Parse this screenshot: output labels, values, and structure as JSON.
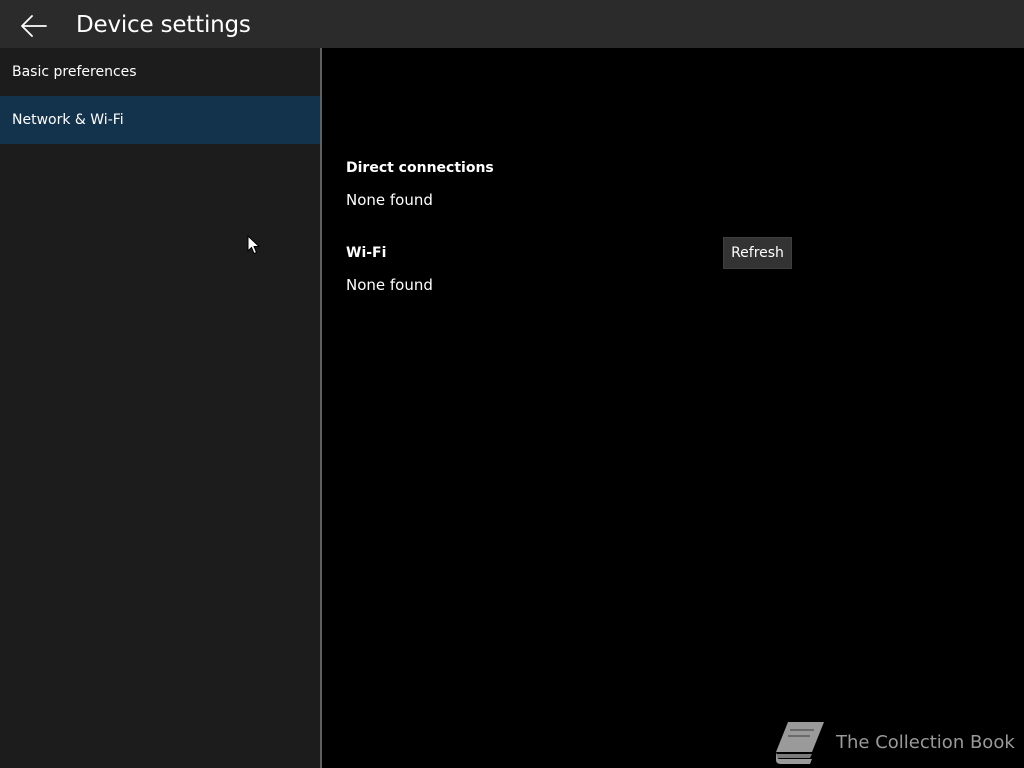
{
  "header": {
    "title": "Device settings",
    "back_icon": "arrow-left-icon"
  },
  "sidebar": {
    "items": [
      {
        "label": "Basic preferences",
        "selected": false
      },
      {
        "label": "Network & Wi-Fi",
        "selected": true
      }
    ]
  },
  "content": {
    "direct": {
      "header": "Direct connections",
      "value": "None found"
    },
    "wifi": {
      "header": "Wi-Fi",
      "value": "None found",
      "refresh_label": "Refresh"
    }
  },
  "watermark": {
    "text": "The Collection Book",
    "icon": "book-icon"
  },
  "colors": {
    "titlebar": "#2b2b2b",
    "sidebar": "#1c1c1c",
    "selected": "#13324c",
    "content": "#000000",
    "divider": "#5f5f5f",
    "button": "#333333"
  }
}
